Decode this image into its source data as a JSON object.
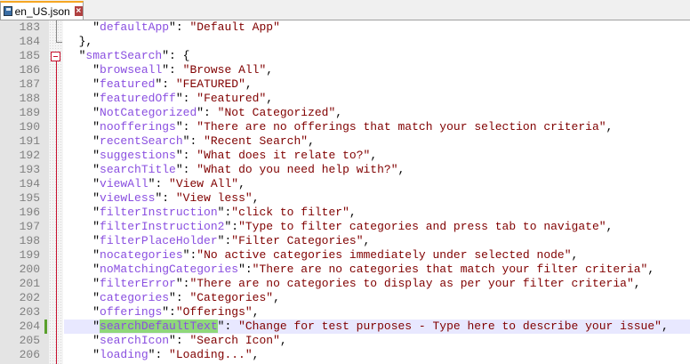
{
  "tab": {
    "title": "en_US.json",
    "close_icon": "close-icon",
    "save_icon": "floppy-icon"
  },
  "current_line": 204,
  "selected_word": "searchDefaultText",
  "colors": {
    "key": "#8a4fe0",
    "value": "#800000",
    "fold": "#c8102e",
    "change_marker": "#5aa02c"
  },
  "lines": [
    {
      "num": "183",
      "indent": 2,
      "key": "defaultApp",
      "sep": ": ",
      "value": "Default App",
      "tail": ""
    },
    {
      "num": "184",
      "indent": 1,
      "raw": "},"
    },
    {
      "num": "185",
      "indent": 1,
      "key": "smartSearch",
      "sep": ": ",
      "raw_tail": "{"
    },
    {
      "num": "186",
      "indent": 2,
      "key": "browseall",
      "sep": ": ",
      "value": "Browse All",
      "tail": ","
    },
    {
      "num": "187",
      "indent": 2,
      "key": "featured",
      "sep": ": ",
      "value": "FEATURED",
      "tail": ","
    },
    {
      "num": "188",
      "indent": 2,
      "key": "featuredOff",
      "sep": ": ",
      "value": "Featured",
      "tail": ","
    },
    {
      "num": "189",
      "indent": 2,
      "key": "NotCategorized",
      "sep": ": ",
      "value": "Not Categorized",
      "tail": ","
    },
    {
      "num": "190",
      "indent": 2,
      "key": "noofferings",
      "sep": ": ",
      "value": "There are no offerings that match your selection criteria",
      "tail": ","
    },
    {
      "num": "191",
      "indent": 2,
      "key": "recentSearch",
      "sep": ": ",
      "value": "Recent Search",
      "tail": ","
    },
    {
      "num": "192",
      "indent": 2,
      "key": "suggestions",
      "sep": ": ",
      "value": "What does it relate to?",
      "tail": ","
    },
    {
      "num": "193",
      "indent": 2,
      "key": "searchTitle",
      "sep": ": ",
      "value": "What do you need help with?",
      "tail": ","
    },
    {
      "num": "194",
      "indent": 2,
      "key": "viewAll",
      "sep": ": ",
      "value": "View All",
      "tail": ","
    },
    {
      "num": "195",
      "indent": 2,
      "key": "viewLess",
      "sep": ": ",
      "value": "View less",
      "tail": ","
    },
    {
      "num": "196",
      "indent": 2,
      "key": "filterInstruction",
      "sep": ":",
      "value": "click to filter",
      "tail": ","
    },
    {
      "num": "197",
      "indent": 2,
      "key": "filterInstruction2",
      "sep": ":",
      "value": "Type to filter categories and press tab to navigate",
      "tail": ","
    },
    {
      "num": "198",
      "indent": 2,
      "key": "filterPlaceHolder",
      "sep": ":",
      "value": "Filter Categories",
      "tail": ","
    },
    {
      "num": "199",
      "indent": 2,
      "key": "nocategories",
      "sep": ":",
      "value": "No active categories immediately under selected node",
      "tail": ","
    },
    {
      "num": "200",
      "indent": 2,
      "key": "noMatchingCategories",
      "sep": ":",
      "value": "There are no categories that match your filter criteria",
      "tail": ","
    },
    {
      "num": "201",
      "indent": 2,
      "key": "filterError",
      "sep": ":",
      "value": "There are no categories to display as per your filter criteria",
      "tail": ","
    },
    {
      "num": "202",
      "indent": 2,
      "key": "categories",
      "sep": ": ",
      "value": "Categories",
      "tail": ","
    },
    {
      "num": "203",
      "indent": 2,
      "key": "offerings",
      "sep": ":",
      "value": "Offerings",
      "tail": ","
    },
    {
      "num": "204",
      "indent": 2,
      "key": "searchDefaultText",
      "sep": ": ",
      "value": "Change for test purposes - Type here to describe your issue",
      "tail": ","
    },
    {
      "num": "205",
      "indent": 2,
      "key": "searchIcon",
      "sep": ": ",
      "value": "Search Icon",
      "tail": ","
    },
    {
      "num": "206",
      "indent": 2,
      "key": "loading",
      "sep": ": ",
      "value": "Loading...",
      "tail": ","
    }
  ]
}
